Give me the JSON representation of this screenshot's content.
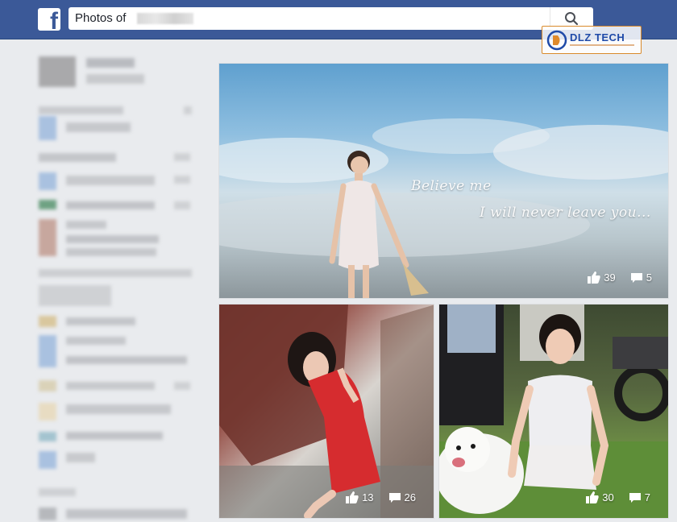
{
  "header": {
    "logo_letter": "f",
    "search": {
      "value": "Photos of"
    }
  },
  "watermark": {
    "text": "DLZ TECH"
  },
  "photos": [
    {
      "captions": [
        "Believe me",
        "I will never leave you..."
      ],
      "likes": "39",
      "comments": "5"
    },
    {
      "likes": "13",
      "comments": "26"
    },
    {
      "likes": "30",
      "comments": "7"
    }
  ],
  "colors": {
    "topbar": "#3b5998",
    "background": "#e9ebee"
  },
  "icons": [
    "facebook-logo-icon",
    "search-icon",
    "like-icon",
    "comment-icon"
  ]
}
